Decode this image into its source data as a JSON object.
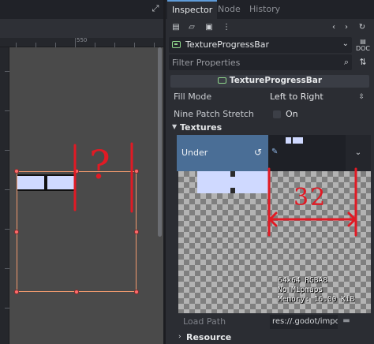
{
  "viewport": {
    "ruler_label": "550"
  },
  "inspector": {
    "tabs": [
      {
        "label": "Inspector",
        "active": true
      },
      {
        "label": "Node",
        "active": false
      },
      {
        "label": "History",
        "active": false
      }
    ],
    "object_name": "TextureProgressBar",
    "filter_placeholder": "Filter Properties",
    "class_header": "TextureProgressBar",
    "properties": {
      "fill_mode": {
        "label": "Fill Mode",
        "value": "Left to Right"
      },
      "nine_patch_stretch": {
        "label": "Nine Patch Stretch",
        "value": "On",
        "checked": false
      }
    },
    "textures": {
      "section_label": "Textures",
      "under_label": "Under",
      "image_info": [
        "64×64 RGBA8",
        "No Mipmaps",
        "Memory: 16.00 KiB"
      ],
      "load_path_label": "Load Path",
      "load_path_value": "res://.godot/impo"
    },
    "resource_section": "Resource"
  },
  "annotations": {
    "size_label": "32",
    "question_mark": "?"
  },
  "colors": {
    "accent_blue": "#5e9bd8",
    "selected_row": "#4a6e96",
    "annotation_red": "#e11a24",
    "node_green": "#8fd68b",
    "selection_orange": "#f19a6e",
    "texture_fill": "#cfd9ff"
  }
}
